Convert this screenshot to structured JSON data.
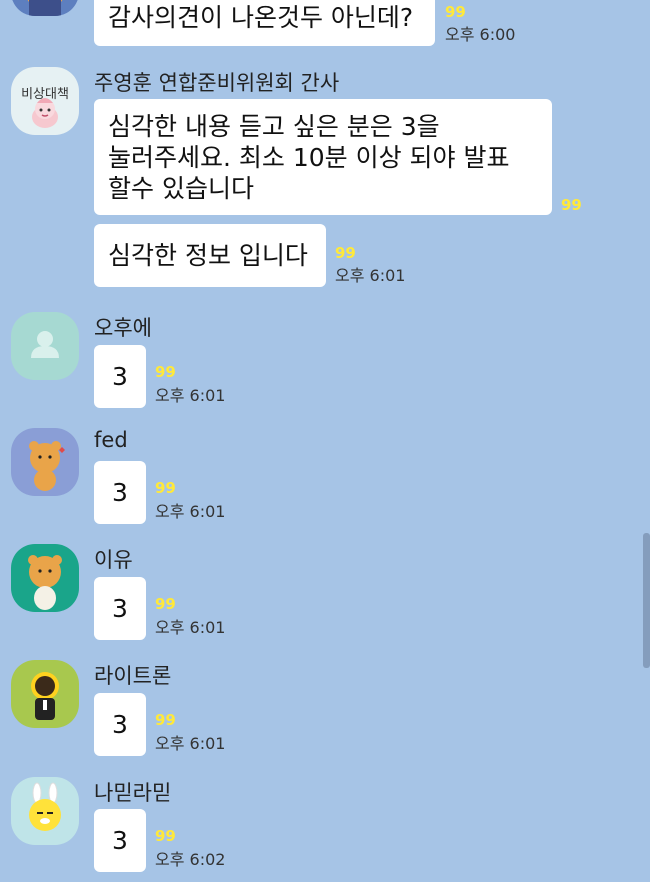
{
  "colors": {
    "background": "#a6c4e6",
    "bubble": "#ffffff",
    "unread": "#ffe93a"
  },
  "messages_top": {
    "text": "감사의견이 나온것두 아닌데?",
    "unread": "99",
    "time": "오후 6:00"
  },
  "group1": {
    "avatar_label": "비상대책",
    "sender": "주영훈 연합준비위원회  간사",
    "msg1_line1": "심각한 내용 듣고 싶은 분은 3을",
    "msg1_line2": "눌러주세요. 최소 10분 이상 되야 발표",
    "msg1_line3": "할수 있습니다",
    "msg1_unread": "99",
    "msg2": "심각한 정보 입니다",
    "msg2_unread": "99",
    "msg2_time": "오후 6:01"
  },
  "chats": [
    {
      "sender": "오후에",
      "text": "3",
      "unread": "99",
      "time": "오후 6:01"
    },
    {
      "sender": "fed",
      "text": "3",
      "unread": "99",
      "time": "오후 6:01"
    },
    {
      "sender": "이유",
      "text": "3",
      "unread": "99",
      "time": "오후 6:01"
    },
    {
      "sender": "라이트론",
      "text": "3",
      "unread": "99",
      "time": "오후 6:01"
    },
    {
      "sender": "나믿라믿",
      "text": "3",
      "unread": "99",
      "time": "오후 6:02"
    }
  ]
}
